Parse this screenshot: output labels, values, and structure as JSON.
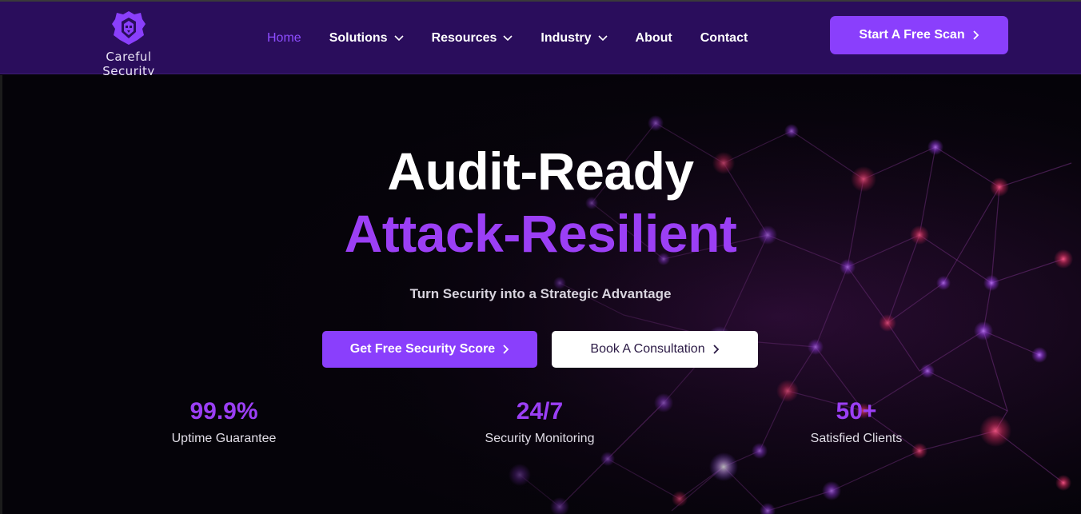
{
  "brand": {
    "name": "Careful Security",
    "accent": "#8a3ffc",
    "nav_bg": "#2a0d5c",
    "headline_purple": "#9b3ff5"
  },
  "nav": {
    "items": [
      {
        "label": "Home",
        "active": true,
        "dropdown": false
      },
      {
        "label": "Solutions",
        "active": false,
        "dropdown": true
      },
      {
        "label": "Resources",
        "active": false,
        "dropdown": true
      },
      {
        "label": "Industry",
        "active": false,
        "dropdown": true
      },
      {
        "label": "About",
        "active": false,
        "dropdown": false
      },
      {
        "label": "Contact",
        "active": false,
        "dropdown": false
      }
    ],
    "cta_label": "Start A Free Scan"
  },
  "hero": {
    "headline_line1": "Audit-Ready",
    "headline_line2": "Attack-Resilient",
    "tagline": "Turn Security into a Strategic Advantage",
    "primary_button": "Get Free Security Score",
    "secondary_button": "Book A Consultation",
    "background": "network-graph-image"
  },
  "stats": [
    {
      "value": "99.9%",
      "label": "Uptime Guarantee"
    },
    {
      "value": "24/7",
      "label": "Security Monitoring"
    },
    {
      "value": "50+",
      "label": "Satisfied Clients"
    }
  ]
}
